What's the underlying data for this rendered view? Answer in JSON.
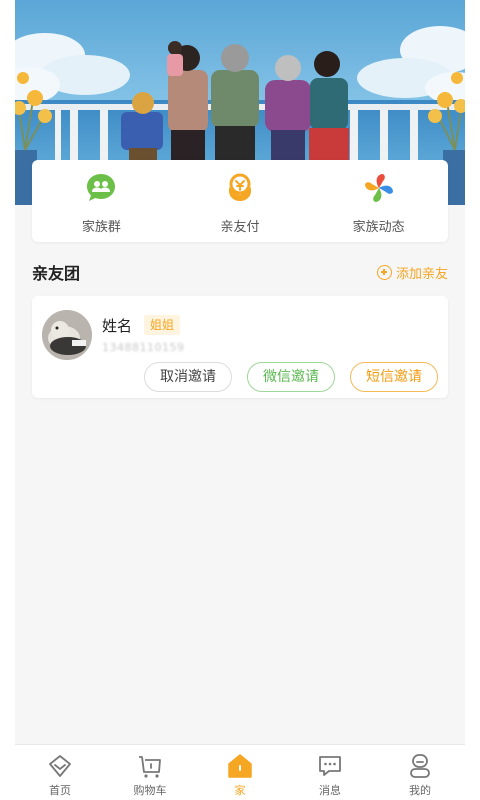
{
  "banner": {
    "sky_color": "#6fb4dc",
    "sea_color": "#3f8fc8"
  },
  "features": [
    {
      "label": "家族群",
      "icon": "family-group-icon",
      "color": "#6cc04a"
    },
    {
      "label": "亲友付",
      "icon": "family-pay-icon",
      "color": "#f5a623"
    },
    {
      "label": "家族动态",
      "icon": "family-moments-icon",
      "color": "#e94e3c"
    }
  ],
  "section": {
    "title": "亲友团",
    "add_label": "添加亲友"
  },
  "member": {
    "name": "姓名",
    "relation": "姐姐",
    "phone": "13488110159",
    "buttons": {
      "cancel": "取消邀请",
      "wechat": "微信邀请",
      "sms": "短信邀请"
    }
  },
  "tabs": [
    {
      "label": "首页",
      "icon": "home-icon"
    },
    {
      "label": "购物车",
      "icon": "cart-icon"
    },
    {
      "label": "家",
      "icon": "family-house-icon",
      "active": true
    },
    {
      "label": "消息",
      "icon": "message-icon"
    },
    {
      "label": "我的",
      "icon": "profile-icon"
    }
  ],
  "colors": {
    "accent": "#f5a623",
    "wechat": "#5ab84f",
    "background": "#f6f6f6"
  }
}
